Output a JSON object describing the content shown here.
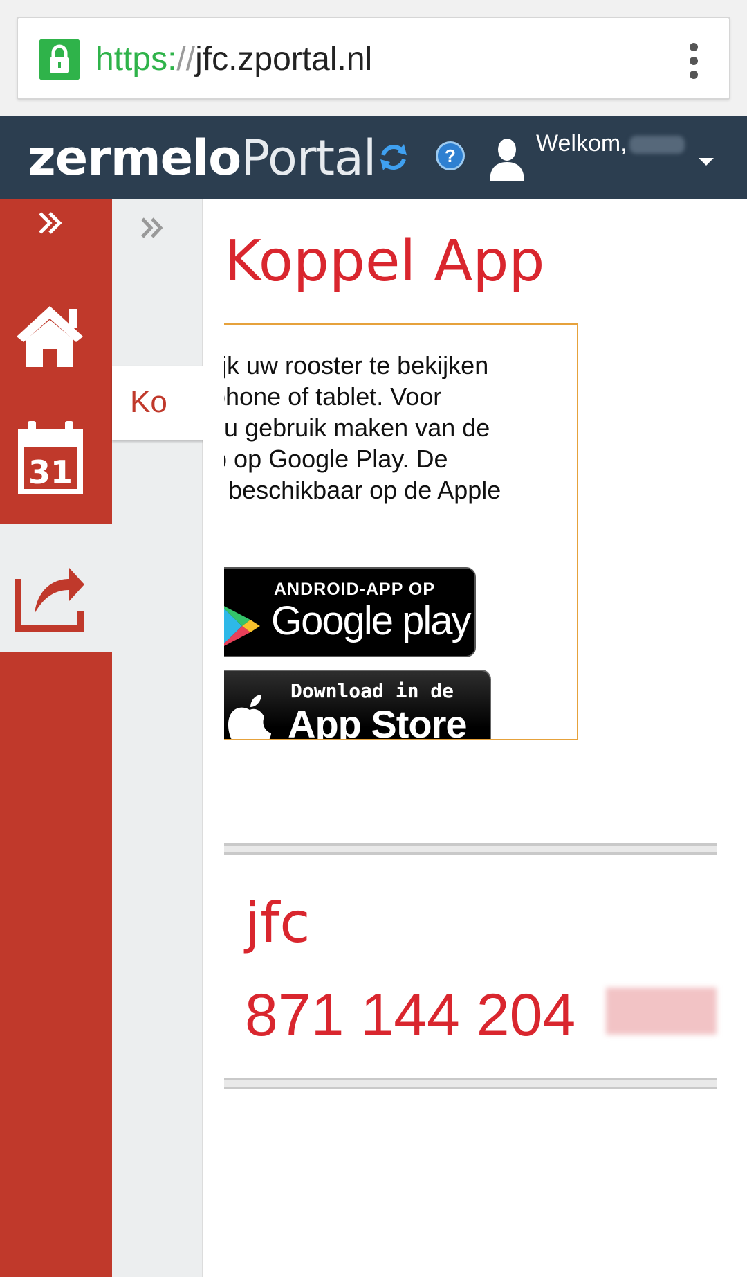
{
  "browser": {
    "url_scheme": "https:",
    "url_sep": "//",
    "url_host": "jfc.zportal.nl"
  },
  "header": {
    "logo_light": "zermelo",
    "logo_bold": "Portal",
    "welcome_text": "Welkom,",
    "help_glyph": "?"
  },
  "sidebar": {
    "second_column_item": "Ko"
  },
  "main": {
    "title": "Koppel App",
    "info_lines": [
      "gelijk uw rooster te bekijken",
      "artphone of tablet. Voor",
      "unt u gebruik maken van de",
      "App op Google Play. De",
      "p is beschikbaar op de Apple",
      ":."
    ],
    "google_badge_small": "ANDROID-APP OP",
    "google_badge_big": "Google play",
    "apple_badge_small": "Download in de",
    "apple_badge_big": "App Store",
    "school_code": "jfc",
    "link_code": "871 144 204"
  },
  "colors": {
    "accent_red": "#c0392b",
    "title_red": "#d9262e",
    "header_bg": "#2c3e50",
    "secure_green": "#2fb34a",
    "box_border": "#e6a23c"
  },
  "icons": [
    "lock-icon",
    "kebab-menu-icon",
    "refresh-icon",
    "help-icon",
    "user-icon",
    "dropdown-caret-icon",
    "expand-chevrons-icon",
    "home-icon",
    "calendar-icon",
    "share-icon",
    "google-play-icon",
    "apple-icon"
  ]
}
